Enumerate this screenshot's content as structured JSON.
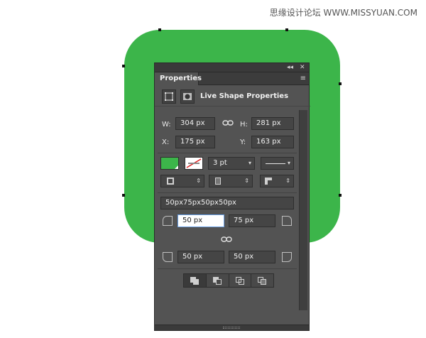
{
  "watermark": "思缘设计论坛 WWW.MISSYUAN.COM",
  "panel": {
    "tab_label": "Properties",
    "titlebar_collapse": "◂◂",
    "titlebar_close": "✕",
    "menu_icon": "≡",
    "header_title": "Live Shape Properties"
  },
  "transform": {
    "w_label": "W:",
    "w_value": "304 px",
    "h_label": "H:",
    "h_value": "281 px",
    "x_label": "X:",
    "x_value": "175 px",
    "y_label": "Y:",
    "y_value": "163 px"
  },
  "appearance": {
    "fill_color": "#3cb54a",
    "stroke_width": "3 pt"
  },
  "corners": {
    "all_value": "50px75px50px50px",
    "top_left": "50 px",
    "top_right": "75 px",
    "bottom_left": "50 px",
    "bottom_right": "50 px"
  },
  "colors": {
    "shape_green": "#3cb54a",
    "panel_bg": "#535353"
  }
}
